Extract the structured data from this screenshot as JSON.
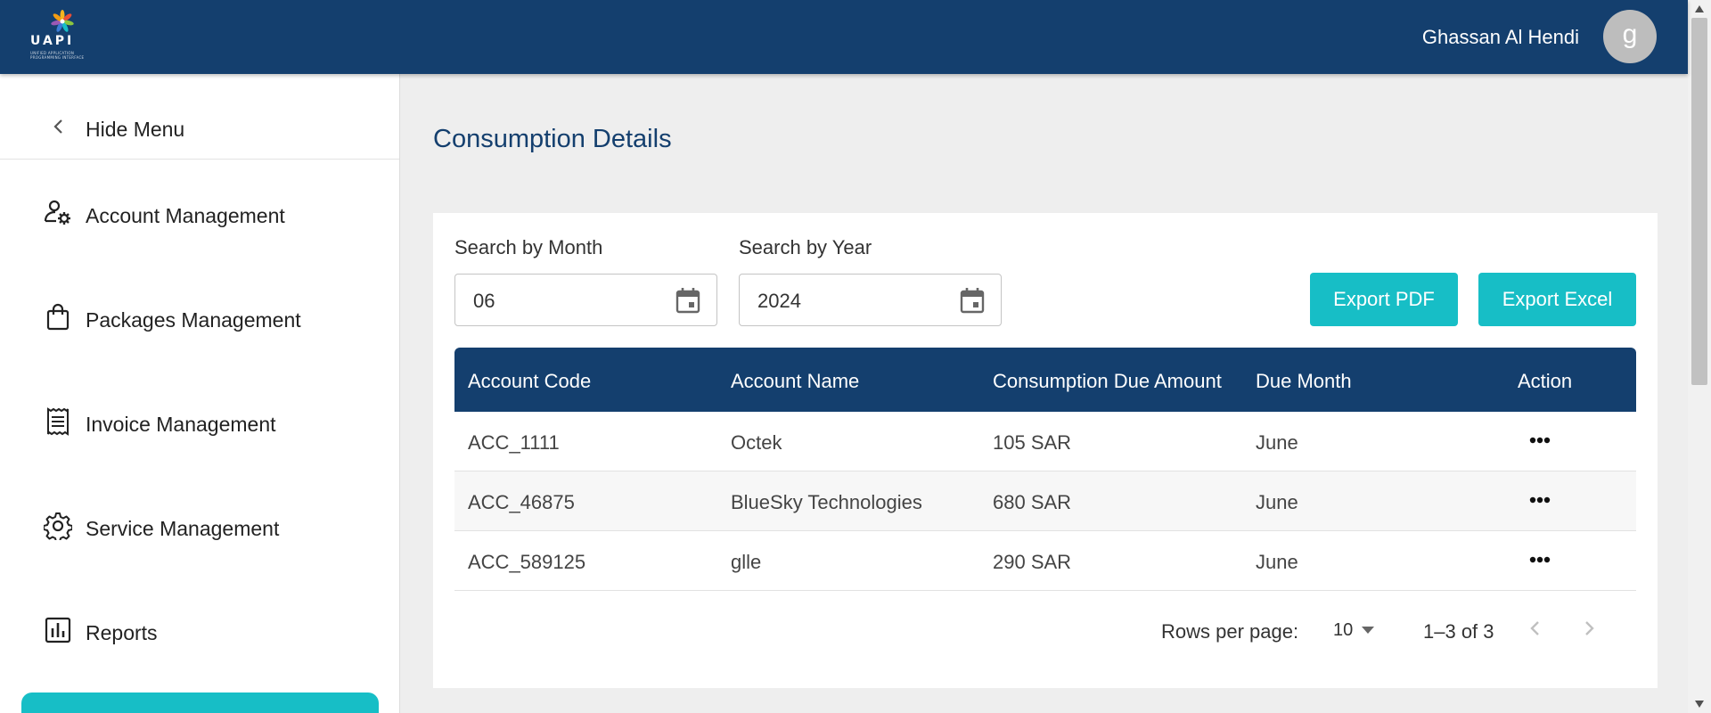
{
  "header": {
    "logo": {
      "word": "UAPI",
      "tagline": "UNIFIED APPLICATION PROGRAMMING INTERFACE"
    },
    "user_name": "Ghassan Al Hendi",
    "avatar_initial": "g"
  },
  "sidebar": {
    "hide_menu_label": "Hide Menu",
    "items": [
      {
        "label": "Account Management",
        "icon": "user-gear-icon"
      },
      {
        "label": "Packages Management",
        "icon": "shopping-bag-icon"
      },
      {
        "label": "Invoice Management",
        "icon": "receipt-icon"
      },
      {
        "label": "Service Management",
        "icon": "gear-icon"
      },
      {
        "label": "Reports",
        "icon": "bar-chart-icon"
      }
    ]
  },
  "main": {
    "title": "Consumption Details",
    "filters": {
      "month_label": "Search by Month",
      "month_value": "06",
      "year_label": "Search by Year",
      "year_value": "2024"
    },
    "buttons": {
      "export_pdf": "Export PDF",
      "export_excel": "Export Excel"
    },
    "table": {
      "columns": [
        "Account Code",
        "Account Name",
        "Consumption Due Amount",
        "Due Month",
        "Action"
      ],
      "rows": [
        [
          "ACC_1111",
          "Octek",
          "105 SAR",
          "June"
        ],
        [
          "ACC_46875",
          "BlueSky Technologies",
          "680 SAR",
          "June"
        ],
        [
          "ACC_589125",
          "glle",
          "290 SAR",
          "June"
        ]
      ]
    },
    "pagination": {
      "rows_per_page_label": "Rows per page:",
      "rows_per_page_value": "10",
      "range": "1–3 of 3"
    }
  },
  "colors": {
    "primary": "#143f6e",
    "accent": "#17bec6",
    "background": "#eeeeee"
  }
}
